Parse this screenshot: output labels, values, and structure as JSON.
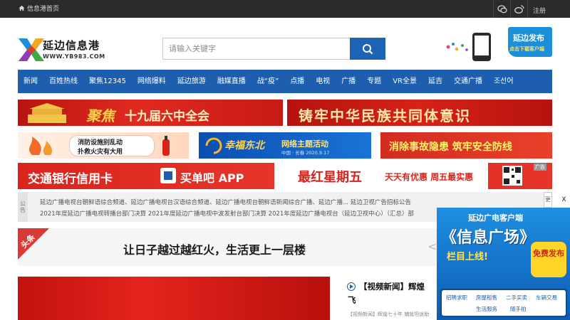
{
  "topbar": {
    "home_label": "信息港首页",
    "register_label": "注册"
  },
  "header": {
    "logo_name": "延边信息港",
    "logo_url": "WWW.YB983.COM",
    "search_placeholder": "请输入关键字",
    "promo_title": "延边发布",
    "promo_sub": "点击下载客户端"
  },
  "nav": {
    "items": [
      "新闻",
      "百姓热线",
      "聚焦12345",
      "网络爆料",
      "延边旅游",
      "融媒直播",
      "战“疫”",
      "点播",
      "电视",
      "广播",
      "专题",
      "VR全景",
      "延吉",
      "交通广播",
      "조선어"
    ]
  },
  "banners": {
    "b1": "十九届六中全会",
    "b2": "铸牢中华民族共同体意识",
    "b3_line1": "消防设施别乱动",
    "b3_line2": "扑救火灾有大用",
    "b4_logo": "幸福东北",
    "b4_text": "网络主题活动",
    "b4_sub": "中国 · 长春  2020.9.17",
    "b5": "消除事故隐患  筑牢安全防线",
    "b6_left": "交通银行信用卡",
    "b6_mid": "买单吧 APP",
    "b6_right": "最红星期五",
    "b6_tail": "天天有优惠 周五最实惠",
    "b6_tag": "广告"
  },
  "notice": {
    "tag": "公告",
    "line1": "延边广播电视台朝鲜语综合频道、延边广播电视台汉语综合频道、延边广播电视台朝鲜语新闻综合广播、延边广播...      延边卫视广告招标公告",
    "line2": "2021年度延边广播电视转播台部门决算      2021年度延边广播电视中波发射台部门决算      2021年度延边广播电视台（延边卫视中心）（汇总）部",
    "more": "更"
  },
  "headline": {
    "ribbon": "头条",
    "title": "让日子越过越红火，生活更上一层楼"
  },
  "video": {
    "title_line1": "【视频新闻】辉煌",
    "title_line2": "飞",
    "desc": "【视频新闻】辉煌七十年 辅就坦途助"
  },
  "side_ad": {
    "close": "X",
    "top": "延边广电客户端",
    "big": "《信息广场》",
    "online": "栏目上线!",
    "free": "免费发布",
    "cats_row1": [
      "招聘求职",
      "房屋租售",
      "二手买卖",
      "车辆交易"
    ],
    "cats_row2": [
      "生活服务",
      "随手拍"
    ]
  },
  "colors": {
    "nav_bg": "#1d5fae",
    "topbar_bg": "#2b2b2b",
    "banner_red": "#c8201b"
  }
}
